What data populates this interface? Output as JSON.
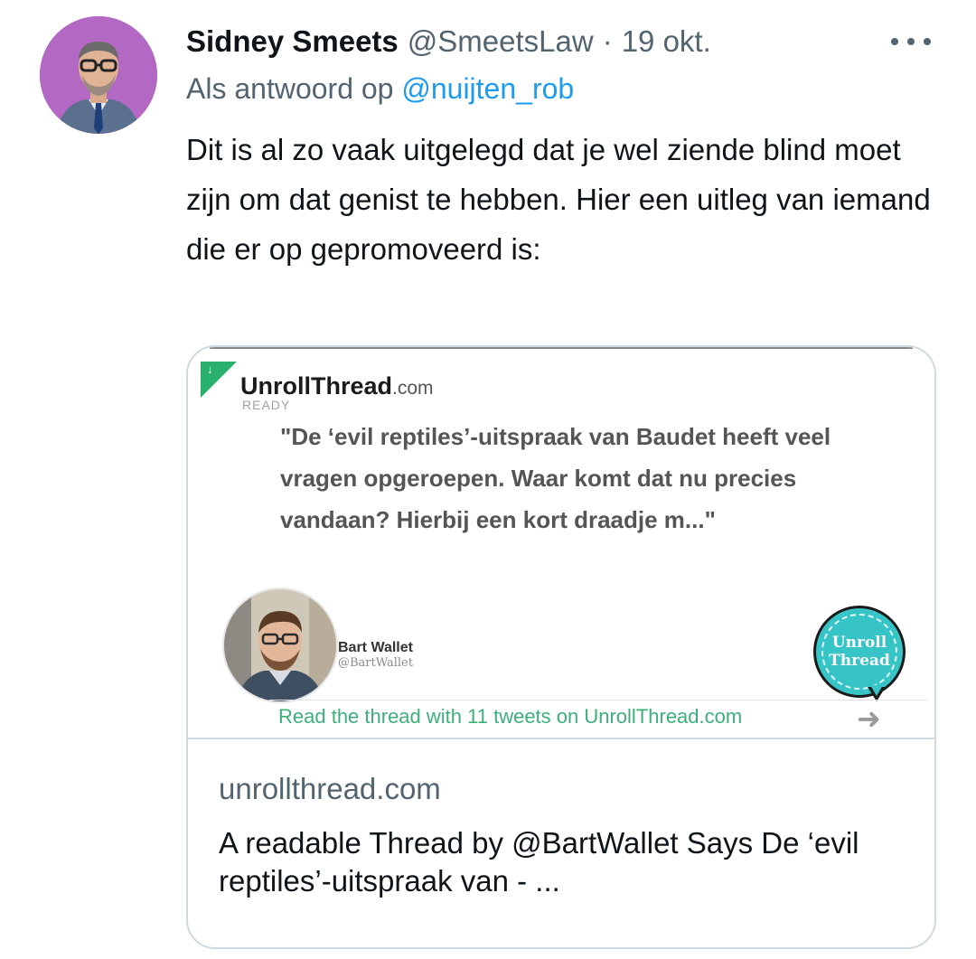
{
  "tweet": {
    "author": {
      "display_name": "Sidney Smeets",
      "handle": "@SmeetsLaw",
      "avatar_icon": "profile-photo"
    },
    "separator": "·",
    "date": "19 okt.",
    "more_icon": "more-dots-icon",
    "reply": {
      "prefix": "Als antwoord op",
      "mention": "@nuijten_rob"
    },
    "text": "Dit is al zo vaak uitgelegd dat je wel ziende blind moet zijn om dat genist te hebben. Hier een uitleg van iemand die er op gepromoveerd is:"
  },
  "card": {
    "image": {
      "brand": "UnrollThread",
      "brand_suffix": ".com",
      "brand_tag": "READY",
      "quote": "\"De ‘evil reptiles’-uitspraak van Baudet heeft veel vragen opgeroepen. Waar komt dat nu precies vandaan? Hierbij een kort draadje m...\"",
      "author_name": "Bart Wallet",
      "author_handle": "@BartWallet",
      "badge_line1": "Unroll",
      "badge_line2": "Thread",
      "read_link": "Read the thread with 11 tweets on UnrollThread.com",
      "arrow_icon": "right-arrow-icon"
    },
    "domain": "unrollthread.com",
    "title": "A readable Thread by @BartWallet Says De ‘evil reptiles’-uitspraak van - ..."
  },
  "colors": {
    "link": "#1d9bf0",
    "secondary_text": "#536471",
    "primary_text": "#0f1419",
    "border": "#cfd9de",
    "unroll_green": "#2ab06e",
    "unroll_teal": "#37c4c6"
  }
}
